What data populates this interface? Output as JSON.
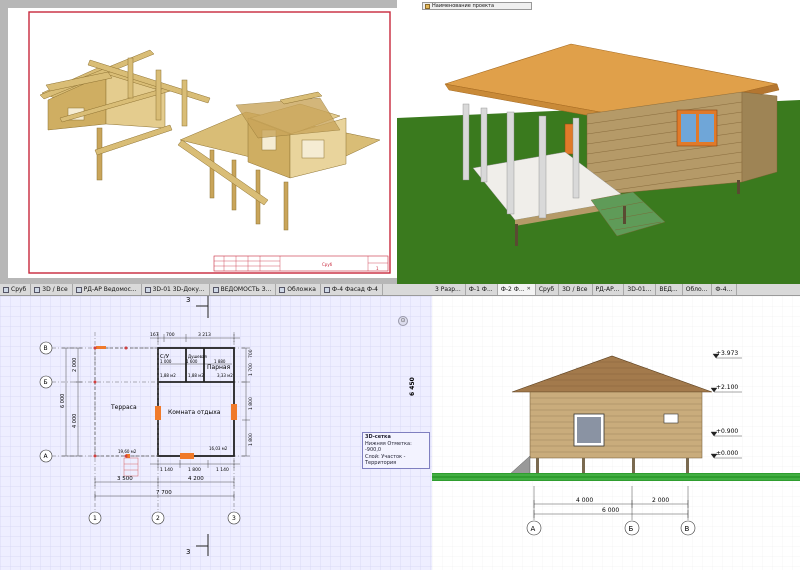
{
  "layout_sheet": {
    "title_block_label": "Сруб",
    "sheet_number": "1"
  },
  "viewer3d": {
    "context_item": "Наименование проекта"
  },
  "tabs_left": [
    {
      "label": "Сруб",
      "active": false
    },
    {
      "label": "3D / Все",
      "active": false
    },
    {
      "label": "РД-АР Ведомос...",
      "active": false
    },
    {
      "label": "3D-01 3D-Доку...",
      "active": false
    },
    {
      "label": "ВЕДОМОСТЬ З...",
      "active": false
    },
    {
      "label": "Обложка",
      "active": false
    },
    {
      "label": "Ф-4 Фасад Ф-4",
      "active": false
    }
  ],
  "tabs_right": [
    {
      "label": "3 Разр...",
      "active": false
    },
    {
      "label": "Ф-1 Ф...",
      "active": false
    },
    {
      "label": "Ф-2 Ф...",
      "active": true
    },
    {
      "label": "Сруб",
      "active": false
    },
    {
      "label": "3D / Все",
      "active": false
    },
    {
      "label": "РД-АР...",
      "active": false
    },
    {
      "label": "3D-01...",
      "active": false
    },
    {
      "label": "ВЕД...",
      "active": false
    },
    {
      "label": "Обло...",
      "active": false
    },
    {
      "label": "Ф-4...",
      "active": false
    }
  ],
  "plan": {
    "section_marker": "3",
    "axis_rows": [
      "В",
      "Б",
      "А"
    ],
    "axis_cols": [
      "1",
      "2",
      "3"
    ],
    "room_terrace": "Терраса",
    "room_terrace_area": "19,60 м2",
    "room_rest": "Комната отдыха",
    "room_rest_area": "16,03 м2",
    "room_wc": "С/У",
    "room_wc_area": "1,88 м2",
    "room_shower": "Душевая",
    "room_shower_area": "1,88 м2",
    "room_steam": "Парная",
    "room_steam_area": "3,33 м2",
    "dim_top_1": "167",
    "dim_top_2": "700",
    "dim_top_3": "3 213",
    "dim_inner_1": "1 000",
    "dim_inner_2": "1 880",
    "dim_inner_3": "1 600",
    "dim_left_1": "2 000",
    "dim_left_2": "4 000",
    "dim_left_total": "6 000",
    "dim_right_total": "6 450",
    "dim_right_1": "700",
    "dim_right_2": "1 700",
    "dim_right_3": "1 800",
    "dim_right_4": "1 800",
    "dim_bottom_1": "1 140",
    "dim_bottom_2": "1 800",
    "dim_bottom_3": "1 140",
    "dim_axis_1": "3 500",
    "dim_axis_2": "4 200",
    "dim_axis_total": "7 700",
    "tooltip_title": "3D-сетка",
    "tooltip_line1": "Нижняя Отметка: -900,0",
    "tooltip_line2": "Слой: Участок - Территория"
  },
  "facade": {
    "level_top": "+3.973",
    "level_2": "+2.100",
    "level_3": "+0.900",
    "level_0": "±0.000",
    "dim_1": "4 000",
    "dim_2": "2 000",
    "dim_total": "6 000",
    "axes": [
      "А",
      "Б",
      "В"
    ]
  },
  "colors": {
    "wood": "#d9bd76",
    "roof": "#e0a04a",
    "grass": "#3a7a1e",
    "plan_bg": "#eeeeff",
    "frame_red": "#c8283c"
  }
}
